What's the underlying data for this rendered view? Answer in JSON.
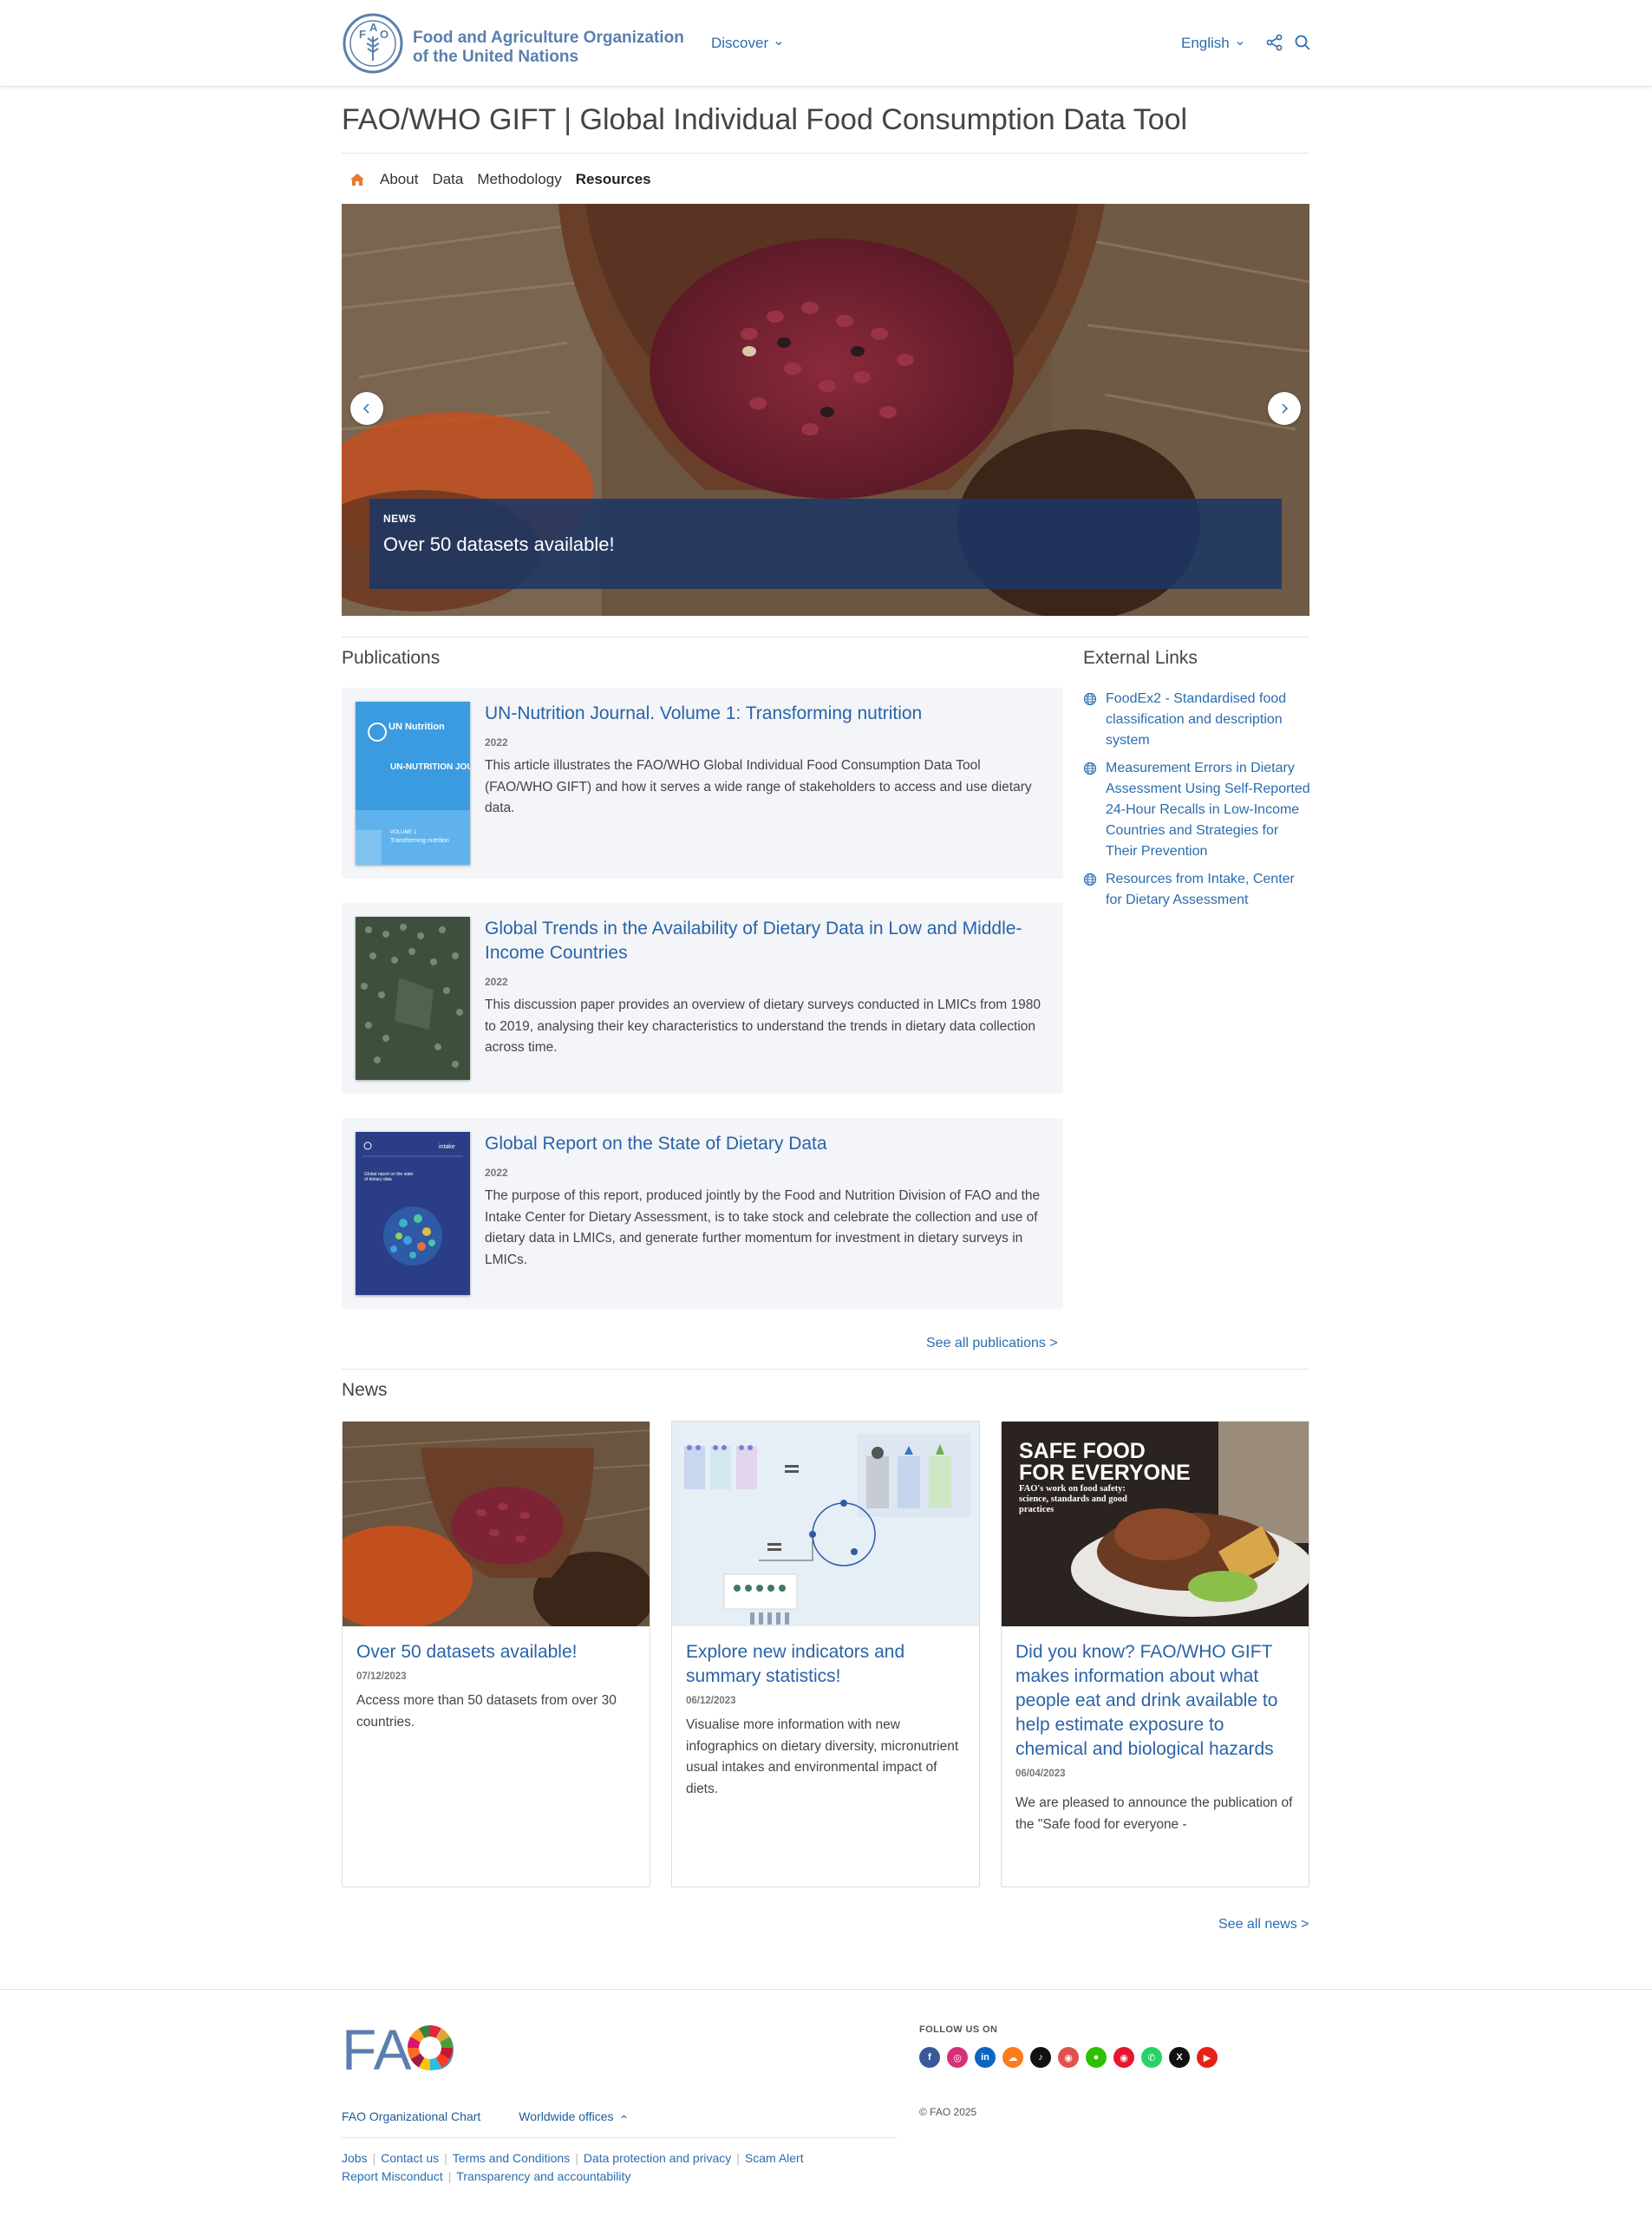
{
  "header": {
    "org_name_line1": "Food and Agriculture Organization",
    "org_name_line2": "of the United Nations",
    "discover": "Discover",
    "language": "English"
  },
  "page": {
    "title": "FAO/WHO GIFT | Global Individual Food Consumption Data Tool"
  },
  "subnav": {
    "items": [
      "About",
      "Data",
      "Methodology",
      "Resources"
    ],
    "active": "Resources"
  },
  "hero": {
    "tag": "NEWS",
    "headline": "Over 50 datasets available!"
  },
  "publications": {
    "title": "Publications",
    "items": [
      {
        "title": "UN-Nutrition Journal. Volume 1: Transforming nutrition",
        "year": "2022",
        "description": "This article illustrates the FAO/WHO Global Individual Food Consumption Data Tool (FAO/WHO GIFT) and how it serves a wide range of stakeholders to access and use dietary data.",
        "cover": {
          "brand": "UN Nutrition",
          "heading": "UN-NUTRITION JOURNAL",
          "volume": "VOLUME 1",
          "subtitle": "Transforming nutrition"
        }
      },
      {
        "title": "Global Trends in the Availability of Dietary Data in Low and Middle-Income Countries",
        "year": "2022",
        "description": "This discussion paper provides an overview of dietary surveys conducted in LMICs from 1980 to 2019, analysing their key characteristics to understand the trends in dietary data collection across time."
      },
      {
        "title": "Global Report on the State of Dietary Data",
        "year": "2022",
        "description": "The purpose of this report, produced jointly by the Food and Nutrition Division of FAO and the Intake Center for Dietary Assessment, is to take stock and celebrate the collection and use of dietary data in LMICs, and generate further momentum for investment in dietary surveys in LMICs.",
        "cover": {
          "brand": "intake",
          "heading": "Global report on the state of dietary data"
        }
      }
    ],
    "see_all": "See all publications >"
  },
  "external_links": {
    "title": "External Links",
    "items": [
      "FoodEx2 - Standardised food classification and description system",
      "Measurement Errors in Dietary Assessment Using Self-Reported 24-Hour Recalls in Low-Income Countries and Strategies for Their Prevention",
      "Resources from Intake, Center for Dietary Assessment"
    ]
  },
  "news": {
    "title": "News",
    "items": [
      {
        "title": "Over 50 datasets available!",
        "date": "07/12/2023",
        "description": "Access more than 50 datasets from over 30 countries."
      },
      {
        "title": "Explore new indicators and summary statistics!",
        "date": "06/12/2023",
        "description": "Visualise more information with new infographics on dietary diversity, micronutrient usual intakes and environmental impact of diets."
      },
      {
        "title": "Did you know? FAO/WHO GIFT makes information about what people eat and drink available to help estimate exposure to chemical and biological hazards",
        "date": "06/04/2023",
        "description": "We are pleased to announce the publication of the \"Safe food for everyone -",
        "image_text": {
          "headline1": "SAFE FOOD",
          "headline2": "FOR EVERYONE",
          "subhead": "FAO's work on food safety: science, standards and good practices"
        }
      }
    ],
    "see_all": "See all news >"
  },
  "footer": {
    "logo_text": "FAO",
    "follow_us": "FOLLOW US ON",
    "socials": [
      "facebook-icon",
      "instagram-icon",
      "linkedin-icon",
      "soundcloud-icon",
      "tiktok-icon",
      "weibo-icon",
      "wechat-icon",
      "weibo-red-icon",
      "whatsapp-icon",
      "x-icon",
      "youtube-icon"
    ],
    "copyright": "© FAO 2025",
    "org_chart": "FAO Organizational Chart",
    "worldwide": "Worldwide offices",
    "links": [
      "Jobs",
      "Contact us",
      "Terms and Conditions",
      "Data protection and privacy",
      "Scam Alert",
      "Report Misconduct",
      "Transparency and accountability"
    ]
  },
  "colors": {
    "brand_blue": "#5a7fae",
    "link_blue": "#2a63a8",
    "caption_bg": "#1c3764",
    "card_bg": "#f3f5f8"
  }
}
